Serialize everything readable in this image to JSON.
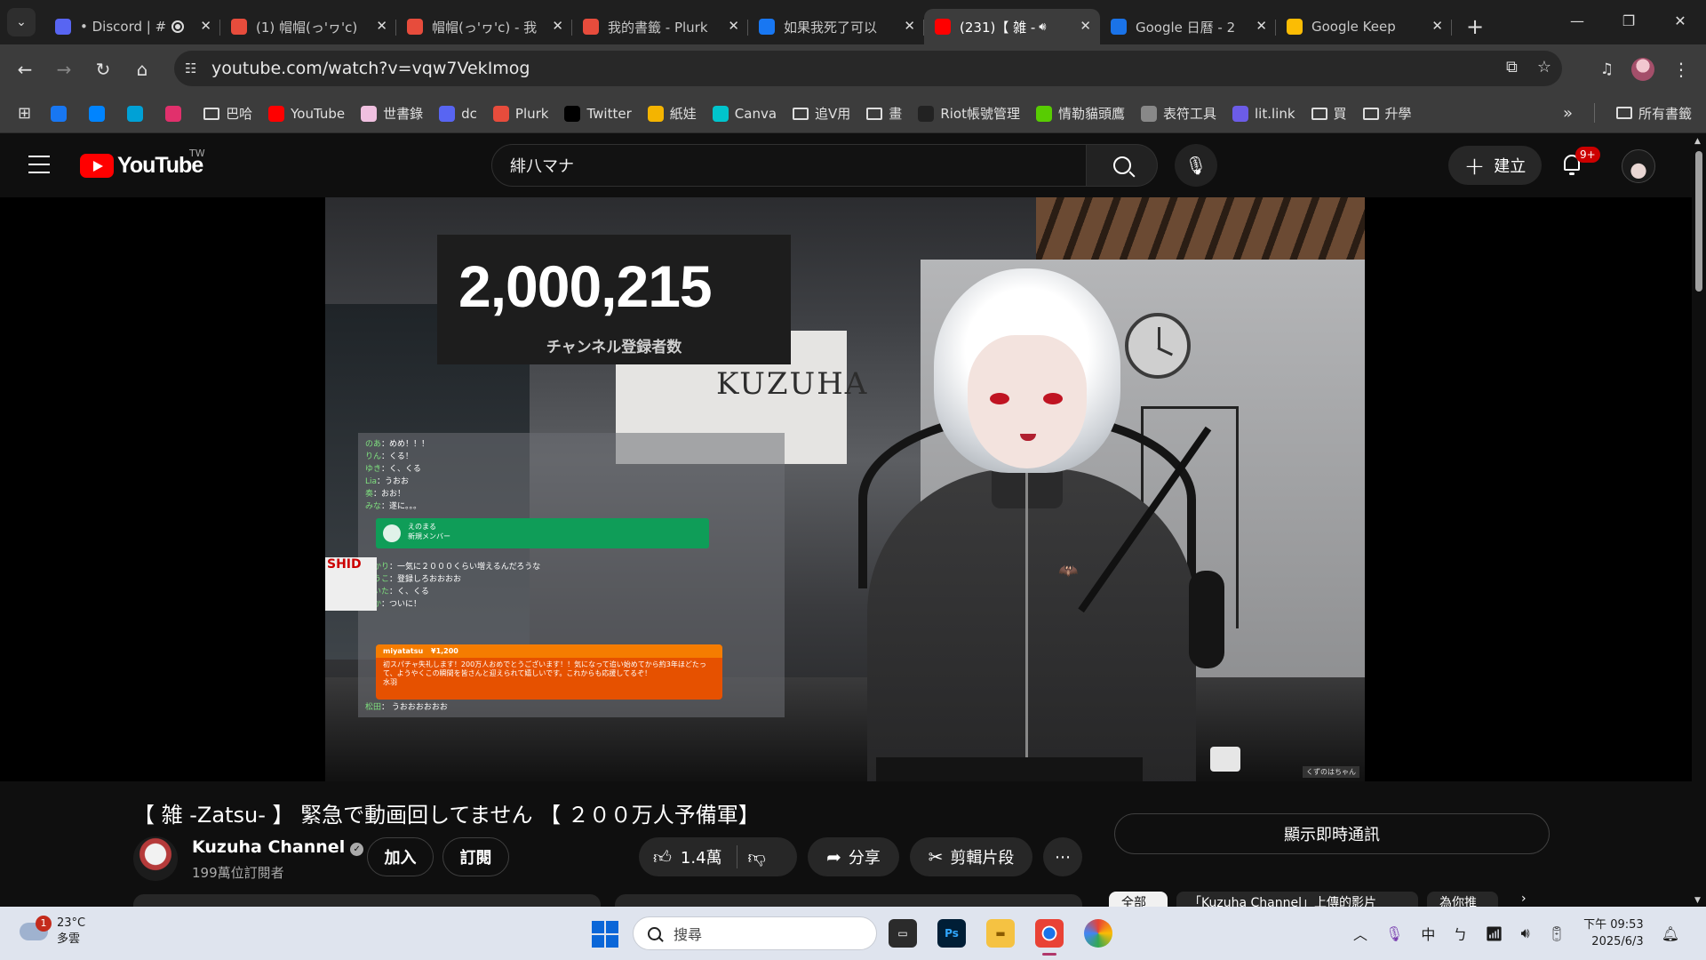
{
  "browser": {
    "tabs": [
      {
        "title": "• Discord | #",
        "favicon_color": "#5865f2",
        "active": false,
        "recording": true
      },
      {
        "title": "(1) 帽帽(っ'ヮ'c)",
        "favicon_color": "#e74c3c",
        "active": false
      },
      {
        "title": "帽帽(っ'ヮ'c) - 我",
        "favicon_color": "#e74c3c",
        "active": false
      },
      {
        "title": "我的書籤 - Plurk",
        "favicon_color": "#e74c3c",
        "active": false
      },
      {
        "title": "如果我死了可以",
        "favicon_color": "#1877f2",
        "active": false
      },
      {
        "title": "(231)【 雑 -",
        "favicon_color": "#ff0000",
        "active": true,
        "audio": true
      },
      {
        "title": "Google 日曆 - 2",
        "favicon_color": "#1a73e8",
        "active": false
      },
      {
        "title": "Google Keep",
        "favicon_color": "#fbbc04",
        "active": false
      }
    ],
    "url": "youtube.com/watch?v=vqw7VekImog",
    "bookmarks": [
      {
        "label": "",
        "icon": "facebook-icon",
        "color": "#1877f2"
      },
      {
        "label": "",
        "icon": "messenger-icon",
        "color": "#0084ff"
      },
      {
        "label": "",
        "icon": "bilibili-icon",
        "color": "#00a1d6"
      },
      {
        "label": "",
        "icon": "instagram-icon",
        "color": "#e1306c"
      },
      {
        "label": "巴哈",
        "icon": "folder-icon"
      },
      {
        "label": "YouTube",
        "icon": "youtube-icon",
        "color": "#ff0000"
      },
      {
        "label": "世書錄",
        "icon": "diamond-icon",
        "color": "#f0c0e0"
      },
      {
        "label": "dc",
        "icon": "discord-icon",
        "color": "#5865f2"
      },
      {
        "label": "Plurk",
        "icon": "plurk-icon",
        "color": "#e74c3c"
      },
      {
        "label": "Twitter",
        "icon": "x-icon",
        "color": "#000000"
      },
      {
        "label": "紙娃",
        "icon": "doll-icon",
        "color": "#f4b400"
      },
      {
        "label": "Canva",
        "icon": "canva-icon",
        "color": "#00c4cc"
      },
      {
        "label": "追V用",
        "icon": "folder-icon"
      },
      {
        "label": "畫",
        "icon": "folder-icon"
      },
      {
        "label": "Riot帳號管理",
        "icon": "riot-icon",
        "color": "#222222"
      },
      {
        "label": "情勒貓頭鷹",
        "icon": "duolingo-icon",
        "color": "#58cc02"
      },
      {
        "label": "表符工具",
        "icon": "globe-icon",
        "color": "#888888"
      },
      {
        "label": "lit.link",
        "icon": "litlink-icon",
        "color": "#6c5ce7"
      },
      {
        "label": "買",
        "icon": "folder-icon"
      },
      {
        "label": "升學",
        "icon": "folder-icon"
      }
    ],
    "all_bookmarks_label": "所有書籤"
  },
  "youtube": {
    "logo_text": "YouTube",
    "region": "TW",
    "search_value": "緋八マナ",
    "create_label": "建立",
    "notification_badge": "9+",
    "video": {
      "subscriber_counter": "2,000,215",
      "counter_caption": "チャンネル登録者数",
      "room_logo": "KUZUHA",
      "chat_lines": [
        {
          "name": "のあ",
          "text": "めめ！！！"
        },
        {
          "name": "りん",
          "text": "くる！"
        },
        {
          "name": "ゆき",
          "text": "く、くる"
        },
        {
          "name": "Lia",
          "text": "うおお"
        },
        {
          "name": "奏",
          "text": "おお！"
        },
        {
          "name": "みな",
          "text": "遂に。。。"
        }
      ],
      "member_name": "えのまる",
      "member_text": "新規メンバー",
      "chat_lines_2": [
        {
          "name": "あかり",
          "text": "一気に２０００くらい増えるんだろうな"
        },
        {
          "name": "ゆうこ",
          "text": "登録しろおおおお"
        },
        {
          "name": "けいた",
          "text": "く、くる"
        },
        {
          "name": "るか",
          "text": "ついに！"
        }
      ],
      "superchat_user": "miyatatsu",
      "superchat_amount": "¥1,200",
      "superchat_text": "初スパチャ失礼します！200万人おめでとうございます！！気になって追い始めてから約3年ほどたって、ようやくこの瞬間を皆さんと迎えられて嬉しいです。これからも応援してるぞ！",
      "superchat_footer": "水羽",
      "chat_last": {
        "name": "松田",
        "text": "うおおおおおお"
      },
      "corner_sign": "SHID",
      "watermark": "くずのはちゃん"
    },
    "title": "【 雑 -Zatsu- 】 緊急で動画回してません 【 ２００万人予備軍】",
    "channel_name": "Kuzuha Channel",
    "subscribers": "199萬位訂閱者",
    "join_label": "加入",
    "subscribe_label": "訂閱",
    "like_count": "1.4萬",
    "share_label": "分享",
    "clip_label": "剪輯片段",
    "more_label": "⋯",
    "live_chat_label": "顯示即時通訊",
    "chips": [
      "全部",
      "「Kuzuha Channel」上傳的影片",
      "為你推"
    ]
  },
  "taskbar": {
    "weather_temp": "23°C",
    "weather_desc": "多雲",
    "weather_badge": "1",
    "search_placeholder": "搜尋",
    "ime": "中",
    "time": "下午 09:53",
    "date": "2025/6/3"
  }
}
